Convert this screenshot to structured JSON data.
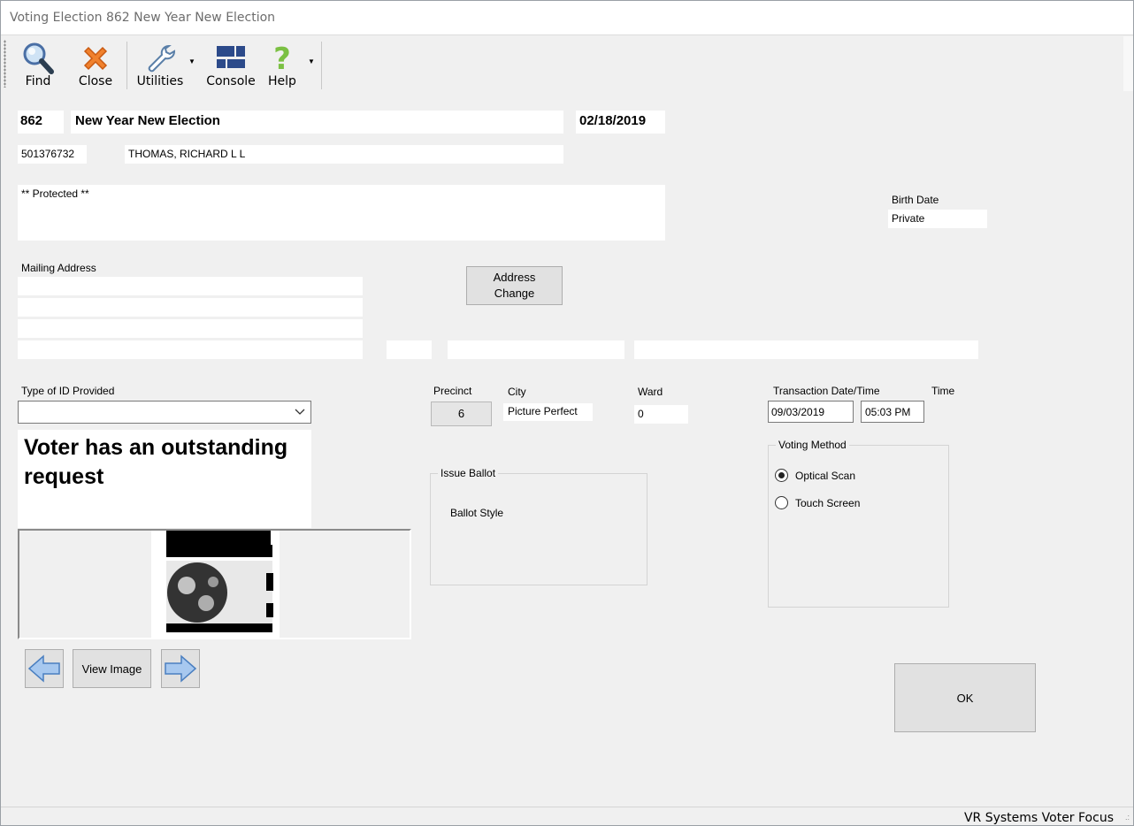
{
  "window": {
    "title": "Voting Election 862 New Year New Election"
  },
  "toolbar": {
    "find": "Find",
    "close": "Close",
    "utilities": "Utilities",
    "console": "Console",
    "help": "Help"
  },
  "election": {
    "number": "862",
    "name": "New Year New Election",
    "date": "02/18/2019"
  },
  "voter": {
    "id": "501376732",
    "name": "THOMAS, RICHARD L L",
    "residence": "** Protected **",
    "birth_date_label": "Birth Date",
    "birth_date": "Private"
  },
  "mailing": {
    "label": "Mailing Address",
    "address_change": "Address\nChange"
  },
  "id_provided": {
    "label": "Type of ID Provided",
    "value": ""
  },
  "alert": "Voter has an outstanding request",
  "precinct": {
    "label": "Precinct",
    "value": "6"
  },
  "city": {
    "label": "City",
    "value": "Picture Perfect"
  },
  "ward": {
    "label": "Ward",
    "value": "0"
  },
  "transaction": {
    "label": "Transaction Date/Time",
    "time_label": "Time",
    "date": "09/03/2019",
    "time": "05:03 PM"
  },
  "issue_ballot": {
    "label": "Issue Ballot",
    "ballot_style": "Ballot Style"
  },
  "voting_method": {
    "label": "Voting Method",
    "options": [
      {
        "label": "Optical Scan",
        "selected": true
      },
      {
        "label": "Touch Screen",
        "selected": false
      }
    ]
  },
  "image_nav": {
    "view_image": "View Image"
  },
  "ok": "OK",
  "status": "VR Systems Voter Focus"
}
